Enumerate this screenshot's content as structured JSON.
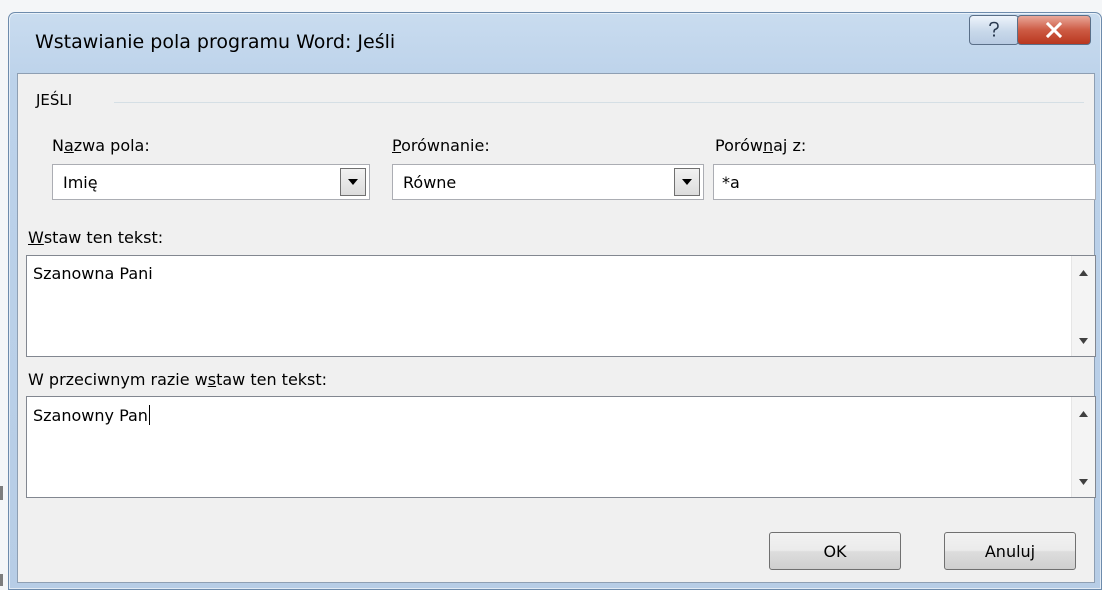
{
  "window": {
    "title": "Wstawianie pola programu Word: Jeśli",
    "help_icon": "question-mark-icon",
    "close_icon": "close-x-icon"
  },
  "group": {
    "label": "JEŚLI"
  },
  "field_name": {
    "label_pre": "N",
    "label_key": "a",
    "label_post": "zwa pola:",
    "value": "Imię"
  },
  "comparison": {
    "label_key": "P",
    "label_post": "orównanie:",
    "value": "Równe"
  },
  "compare_to": {
    "label_pre": "Porów",
    "label_key": "n",
    "label_post": "aj z:",
    "value": "*a"
  },
  "insert_text": {
    "label_key": "W",
    "label_post": "staw ten tekst:",
    "value": "Szanowna Pani"
  },
  "otherwise_text": {
    "label_pre": "W przeciwnym razie w",
    "label_key": "s",
    "label_post": "taw ten tekst:",
    "value": "Szanowny Pan"
  },
  "buttons": {
    "ok": "OK",
    "cancel": "Anuluj"
  },
  "colors": {
    "title_bar": "#bcd2ea",
    "close_button": "#cd5b44",
    "client_bg": "#f0f0f0"
  }
}
